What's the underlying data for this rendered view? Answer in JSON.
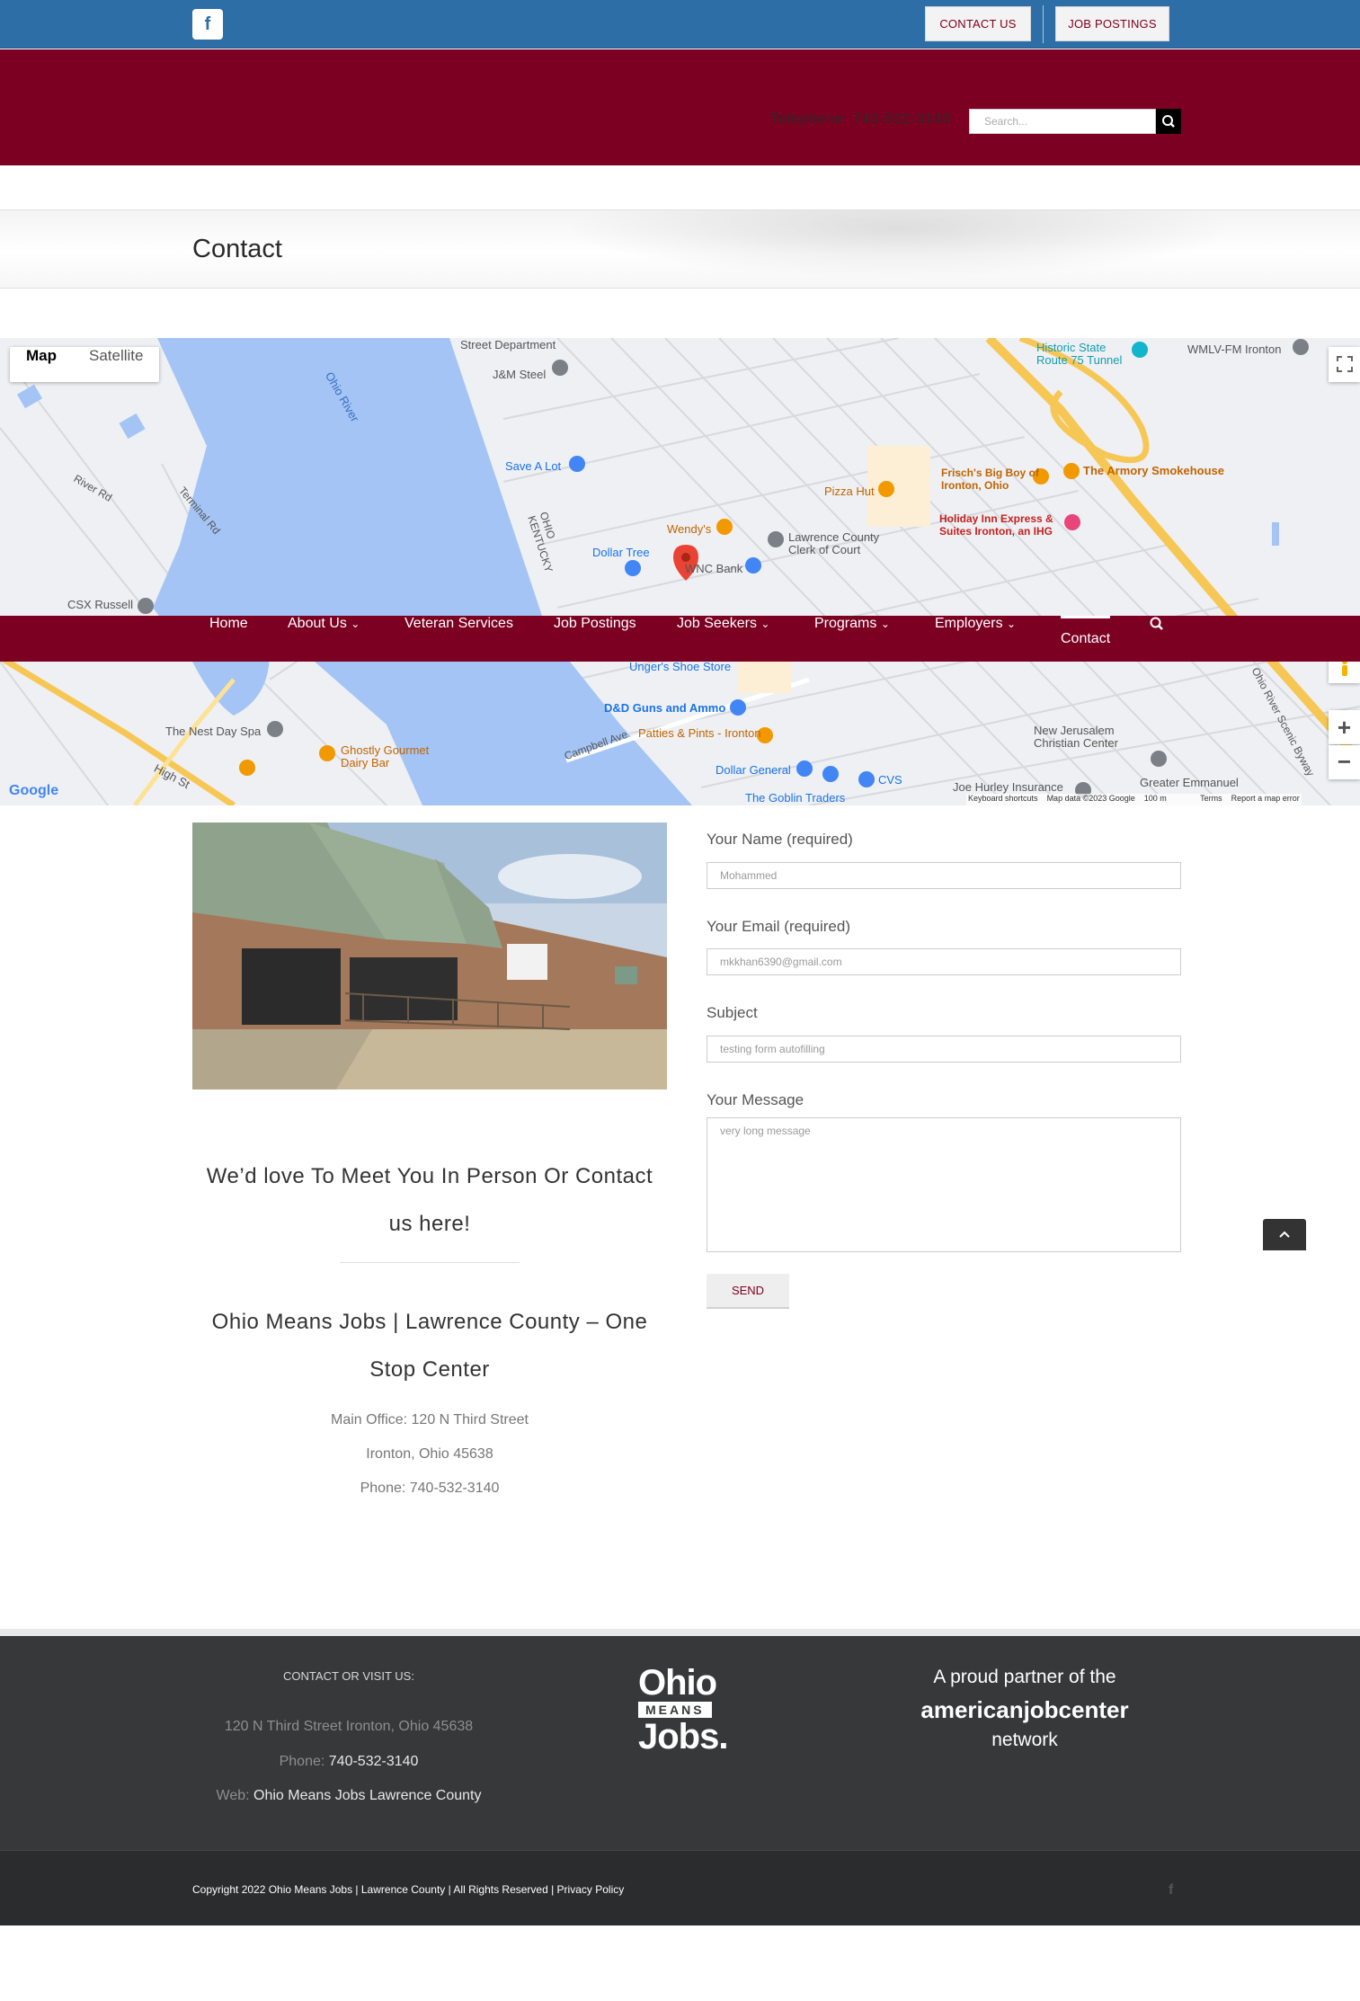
{
  "topbar": {
    "facebook_icon": "f",
    "contact_us": "CONTACT US",
    "job_postings": "JOB POSTINGS"
  },
  "header": {
    "telephone": "Telephone: 740-532-3140",
    "search_placeholder": "Search..."
  },
  "page_title": "Contact",
  "map": {
    "type_map": "Map",
    "type_satellite": "Satellite",
    "google_logo": "Google",
    "keyboard_shortcuts": "Keyboard shortcuts",
    "map_data": "Map data ©2023 Google",
    "scale": "100 m",
    "terms": "Terms",
    "report": "Report a map error",
    "labels": {
      "street_dept": "Street Department",
      "jm_steel": "J&M Steel",
      "ohio_river": "Ohio River",
      "save_a_lot": "Save A Lot",
      "dollar_tree": "Dollar Tree",
      "wendys": "Wendy's",
      "wnc_bank": "WNC Bank",
      "pizza_hut": "Pizza Hut",
      "lawrence_clerk": "Lawrence County Clerk of Court",
      "frischs": "Frisch's Big Boy of Ironton, Ohio",
      "armory": "The Armory Smokehouse",
      "holiday_inn": "Holiday Inn Express & Suites Ironton, an IHG",
      "historic_state": "Historic State Route 75 Tunnel",
      "wmlv": "WMLV-FM Ironton",
      "csx": "CSX Russell",
      "ohio_kentucky": "OHIO KENTUCKY",
      "ungers": "Unger's Shoe Store",
      "dd_guns": "D&D Guns and Ammo",
      "patties": "Patties & Pints - Ironton",
      "dollar_general": "Dollar General",
      "cvs": "CVS",
      "goblin": "The Goblin Traders",
      "nest_day_spa": "The Nest Day Spa",
      "ghostly": "Ghostly Gourmet Dairy Bar",
      "new_jerusalem": "New Jerusalem Christian Center",
      "joe_hurley": "Joe Hurley Insurance",
      "greater_emmanuel": "Greater Emmanuel",
      "scenic_byway": "Ohio River Scenic Byway",
      "high_st": "High St",
      "campbell_ave": "Campbell Ave",
      "river_rd": "River Rd",
      "terminal_rd": "Terminal Rd"
    }
  },
  "nav": {
    "items": [
      "Home",
      "About Us",
      "Veteran Services",
      "Job Postings",
      "Job Seekers",
      "Programs",
      "Employers",
      "Contact"
    ],
    "dropdown_marker": "⌄",
    "search_icon": "⚲"
  },
  "form": {
    "name_label": "Your Name (required)",
    "name_value": "Mohammed",
    "email_label": "Your Email (required)",
    "email_value": "mkkhan6390@gmail.com",
    "subject_label": "Subject",
    "subject_value": "testing form autofilling",
    "message_label": "Your Message",
    "message_value": "very long message",
    "send": "SEND"
  },
  "contact": {
    "heading": "We’d love To Meet You In Person Or Contact us here!",
    "org": "Ohio Means Jobs | Lawrence County – One Stop Center",
    "office": "Main Office: 120 N Third Street",
    "city": "Ironton, Ohio 45638",
    "phone": "Phone: 740-532-3140"
  },
  "footer": {
    "heading": "CONTACT OR VISIT US:",
    "address": "120 N Third Street Ironton, Ohio 45638",
    "phone_label": "Phone:",
    "phone_value": "740-532-3140",
    "web_label": "Web:",
    "web_value": "Ohio Means Jobs Lawrence County",
    "ohio_logo_line1": "Ohio",
    "ohio_logo_line2": "MEANS",
    "ohio_logo_line3": "Jobs.",
    "ajc_line1": "A proud partner of the",
    "ajc_line2": "americanjobcenter",
    "ajc_line3": "network",
    "copyright": "Copyright 2022 Ohio Means Jobs | Lawrence County | All Rights Reserved | Privacy Policy",
    "facebook_icon": "f"
  },
  "colors": {
    "topbar": "#2e6ea6",
    "brand_maroon": "#7b0022",
    "footer": "#363839",
    "river": "#a3c4f5",
    "highway": "#f7c755"
  }
}
